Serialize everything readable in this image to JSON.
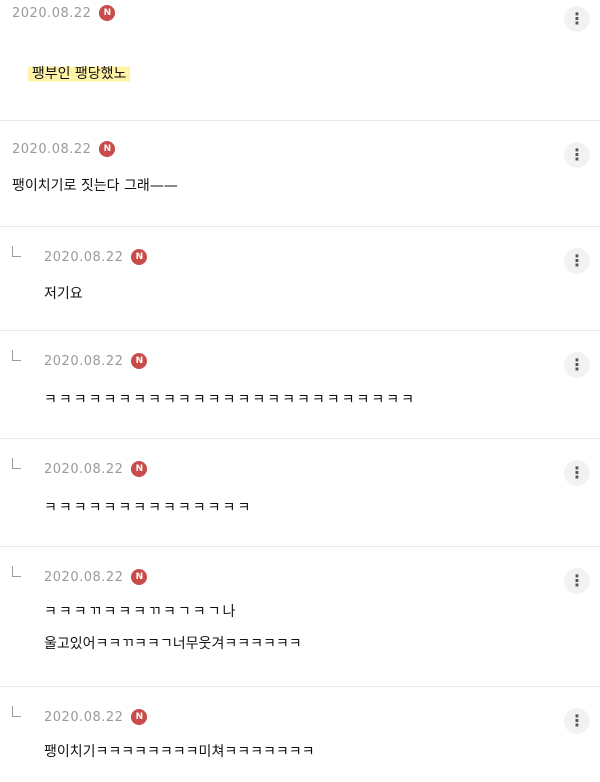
{
  "comments": [
    {
      "date": "2020.08.22",
      "badge": "N",
      "text": "팽부인 팽당했노",
      "highlight": true
    },
    {
      "date": "2020.08.22",
      "badge": "N",
      "text": "팽이치기로 짓는다 그래——"
    },
    {
      "date": "2020.08.22",
      "badge": "N",
      "text": "저기요",
      "reply": true
    },
    {
      "date": "2020.08.22",
      "badge": "N",
      "text": "ㅋㅋㅋㅋㅋㅋㅋㅋㅋㅋㅋㅋㅋㅋㅋㅋㅋㅋㅋㅋㅋㅋㅋㅋㅋ",
      "reply": true
    },
    {
      "date": "2020.08.22",
      "badge": "N",
      "text": "ㅋㅋㅋㅋㅋㅋㅋㅋㅋㅋㅋㅋㅋㅋ",
      "reply": true
    },
    {
      "date": "2020.08.22",
      "badge": "N",
      "text_line1": "ㅋㅋㅋㄲㅋㅋㅋㄲㅋㄱㅋㄱ나",
      "text_line2": "울고있어ㅋㅋㄲㅋㅋㄱ너무웃겨ㅋㅋㅋㅋㅋㅋ",
      "reply": true
    },
    {
      "date": "2020.08.22",
      "badge": "N",
      "text": "팽이치기ㅋㅋㅋㅋㅋㅋㅋㅋ미쳐ㅋㅋㅋㅋㅋㅋㅋ",
      "reply": true
    }
  ],
  "more_icon": "more-vertical-icon",
  "colors": {
    "badge": "#c94b4b",
    "highlight": "#fff3a8",
    "date": "#9a9a9a"
  }
}
